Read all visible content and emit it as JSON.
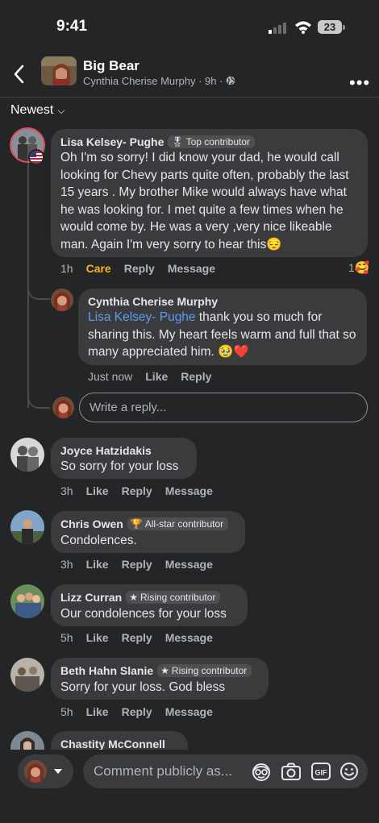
{
  "status": {
    "time": "9:41",
    "battery": "23"
  },
  "header": {
    "title": "Big Bear",
    "author": "Cynthia Cherise Murphy",
    "meta": " · 9h · "
  },
  "sort": {
    "label": "Newest"
  },
  "comments": [
    {
      "name": "Lisa Kelsey- Pughe",
      "badge": "Top contributor",
      "text": "Oh I'm so sorry! I did know your dad, he would call looking for Chevy parts quite often, probably the last 15 years . My brother Mike would always have what he  was looking for. I met quite a few times when he would come by. He was a very ,very nice likeable man. Again I'm very sorry to hear this",
      "time": "1h",
      "reaction": "Care",
      "reply": "Reply",
      "message": "Message",
      "reaction_count": "1"
    },
    {
      "name": "Joyce Hatzidakis",
      "text": "So sorry for your loss",
      "time": "3h",
      "like": "Like",
      "reply": "Reply",
      "message": "Message"
    },
    {
      "name": "Chris Owen",
      "badge": "All-star contributor",
      "text": "Condolences.",
      "time": "3h",
      "like": "Like",
      "reply": "Reply",
      "message": "Message"
    },
    {
      "name": "Lizz Curran",
      "badge": "Rising contributor",
      "text": "Our condolences for your loss",
      "time": "5h",
      "like": "Like",
      "reply": "Reply",
      "message": "Message"
    },
    {
      "name": "Beth Hahn Slanie",
      "badge": "Rising contributor",
      "text": "Sorry for your loss. God bless",
      "time": "5h",
      "like": "Like",
      "reply": "Reply",
      "message": "Message"
    },
    {
      "name": "Chastity McConnell"
    }
  ],
  "reply": {
    "name": "Cynthia Cherise Murphy",
    "mention": "Lisa Kelsey- Pughe",
    "text": " thank you so much for sharing this. My heart feels warm and full that so many appreciated him.",
    "time": "Just now",
    "like": "Like",
    "reply": "Reply"
  },
  "reply_input": {
    "placeholder": "Write a reply..."
  },
  "composer": {
    "placeholder": "Comment publicly as..."
  },
  "colors": {
    "background": "#242526",
    "bubble": "#3a3b3c",
    "care": "#f7b125",
    "mention": "#5b9cf1"
  }
}
